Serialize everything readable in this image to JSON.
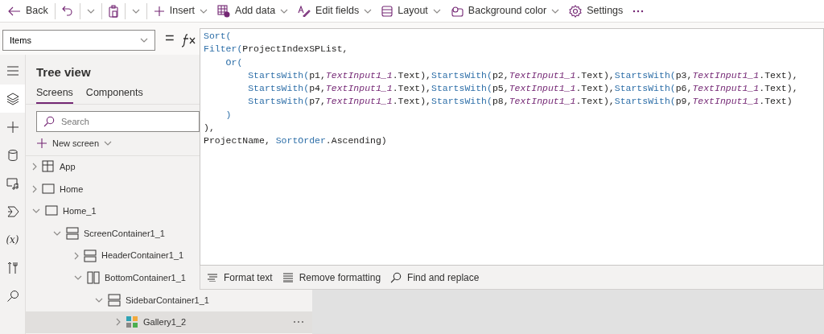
{
  "toolbar": {
    "items": [
      {
        "kind": "back",
        "label": "Back",
        "dropdown": false
      },
      {
        "kind": "undo",
        "dropdown": true
      },
      {
        "kind": "paste",
        "dropdown": true
      },
      {
        "kind": "insert",
        "label": "Insert",
        "dropdown": true
      },
      {
        "kind": "add-data",
        "label": "Add data",
        "dropdown": true
      },
      {
        "kind": "edit-fields",
        "label": "Edit fields",
        "dropdown": true
      },
      {
        "kind": "layout",
        "label": "Layout",
        "dropdown": true
      },
      {
        "kind": "background",
        "label": "Background color",
        "dropdown": true
      },
      {
        "kind": "settings",
        "label": "Settings",
        "dropdown": false
      },
      {
        "kind": "more",
        "dropdown": false
      }
    ]
  },
  "formula_bar": {
    "property": "Items",
    "equals": "=",
    "lines": [
      {
        "tokens": [
          {
            "kind": "function",
            "text": "Sort("
          }
        ]
      },
      {
        "tokens": [
          {
            "kind": "function",
            "text": "Filter("
          },
          {
            "kind": "plain",
            "text": "ProjectIndexSPList,"
          }
        ]
      },
      {
        "tokens": [
          {
            "kind": "function",
            "text": "    Or("
          }
        ]
      },
      {
        "tokens": [
          {
            "kind": "function",
            "text": "        StartsWith("
          },
          {
            "kind": "plain",
            "text": "p1,"
          },
          {
            "kind": "control",
            "text": "TextInput1_1"
          },
          {
            "kind": "plain",
            "text": ".Text),"
          },
          {
            "kind": "function",
            "text": "StartsWith("
          },
          {
            "kind": "plain",
            "text": "p2,"
          },
          {
            "kind": "control",
            "text": "TextInput1_1"
          },
          {
            "kind": "plain",
            "text": ".Text),"
          },
          {
            "kind": "function",
            "text": "StartsWith("
          },
          {
            "kind": "plain",
            "text": "p3,"
          },
          {
            "kind": "control",
            "text": "TextInput1_1"
          },
          {
            "kind": "plain",
            "text": ".Text),"
          }
        ]
      },
      {
        "tokens": [
          {
            "kind": "function",
            "text": "        StartsWith("
          },
          {
            "kind": "plain",
            "text": "p4,"
          },
          {
            "kind": "control",
            "text": "TextInput1_1"
          },
          {
            "kind": "plain",
            "text": ".Text),"
          },
          {
            "kind": "function",
            "text": "StartsWith("
          },
          {
            "kind": "plain",
            "text": "p5,"
          },
          {
            "kind": "control",
            "text": "TextInput1_1"
          },
          {
            "kind": "plain",
            "text": ".Text),"
          },
          {
            "kind": "function",
            "text": "StartsWith("
          },
          {
            "kind": "plain",
            "text": "p6,"
          },
          {
            "kind": "control",
            "text": "TextInput1_1"
          },
          {
            "kind": "plain",
            "text": ".Text),"
          }
        ]
      },
      {
        "tokens": [
          {
            "kind": "function",
            "text": "        StartsWith("
          },
          {
            "kind": "plain",
            "text": "p7,"
          },
          {
            "kind": "control",
            "text": "TextInput1_1"
          },
          {
            "kind": "plain",
            "text": ".Text),"
          },
          {
            "kind": "function",
            "text": "StartsWith("
          },
          {
            "kind": "plain",
            "text": "p8,"
          },
          {
            "kind": "control",
            "text": "TextInput1_1"
          },
          {
            "kind": "plain",
            "text": ".Text),"
          },
          {
            "kind": "function",
            "text": "StartsWith("
          },
          {
            "kind": "plain",
            "text": "p9,"
          },
          {
            "kind": "control",
            "text": "TextInput1_1"
          },
          {
            "kind": "plain",
            "text": ".Text)"
          }
        ]
      },
      {
        "tokens": [
          {
            "kind": "function",
            "text": "    )"
          }
        ]
      },
      {
        "tokens": [
          {
            "kind": "plain",
            "text": "),"
          }
        ]
      },
      {
        "tokens": [
          {
            "kind": "plain",
            "text": "ProjectName, "
          },
          {
            "kind": "function",
            "text": "SortOrder"
          },
          {
            "kind": "plain",
            "text": ".Ascending)"
          }
        ]
      }
    ],
    "actions": [
      {
        "kind": "format",
        "label": "Format text"
      },
      {
        "kind": "remove",
        "label": "Remove formatting"
      },
      {
        "kind": "find",
        "label": "Find and replace"
      }
    ]
  },
  "rail": [
    {
      "kind": "menu",
      "selected": false
    },
    {
      "kind": "layers",
      "selected": true
    },
    {
      "kind": "insert",
      "selected": false
    },
    {
      "kind": "data",
      "selected": false
    },
    {
      "kind": "media",
      "selected": false
    },
    {
      "kind": "flows",
      "selected": false
    },
    {
      "kind": "variables",
      "glyph": "(x)",
      "selected": false
    },
    {
      "kind": "tools",
      "selected": false
    },
    {
      "kind": "search",
      "selected": false
    }
  ],
  "tree_view": {
    "title": "Tree view",
    "tabs": [
      {
        "label": "Screens",
        "selected": true
      },
      {
        "label": "Components",
        "selected": false
      }
    ],
    "search": {
      "placeholder": "Search"
    },
    "new_screen": "New screen",
    "items": [
      {
        "label": "App",
        "kind": "app",
        "expanded": false,
        "selected": false
      },
      {
        "label": "Home",
        "kind": "screen",
        "expanded": false,
        "selected": false
      },
      {
        "label": "Home_1",
        "kind": "screen",
        "expanded": true,
        "selected": false,
        "children": [
          {
            "label": "ScreenContainer1_1",
            "kind": "hcontainer",
            "expanded": true,
            "selected": false,
            "children": [
              {
                "label": "HeaderContainer1_1",
                "kind": "hcontainer",
                "expanded": false,
                "selected": false
              },
              {
                "label": "BottomContainer1_1",
                "kind": "vcontainer",
                "expanded": true,
                "selected": false,
                "children": [
                  {
                    "label": "SidebarContainer1_1",
                    "kind": "hcontainer",
                    "expanded": true,
                    "selected": false,
                    "children": [
                      {
                        "label": "Gallery1_2",
                        "kind": "gallery",
                        "expanded": false,
                        "selected": true
                      }
                    ]
                  }
                ]
              }
            ]
          }
        ]
      }
    ]
  }
}
